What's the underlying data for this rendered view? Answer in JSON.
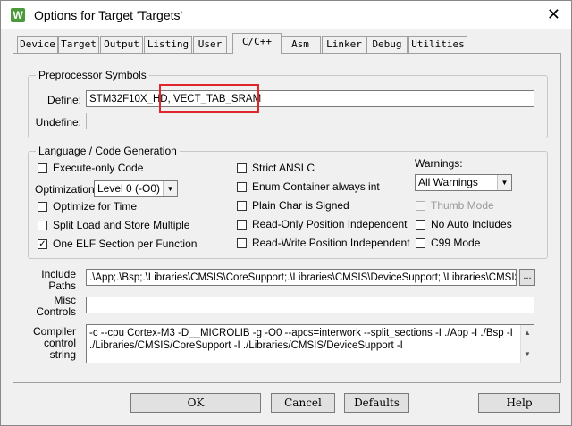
{
  "window": {
    "title": "Options for Target 'Targets'",
    "icon_letter": "W",
    "close_glyph": "✕"
  },
  "tabs": [
    {
      "label": "Device",
      "active": false
    },
    {
      "label": "Target",
      "active": false
    },
    {
      "label": "Output",
      "active": false
    },
    {
      "label": "Listing",
      "active": false
    },
    {
      "label": "User",
      "active": false
    },
    {
      "label": "C/C++",
      "active": true
    },
    {
      "label": "Asm",
      "active": false
    },
    {
      "label": "Linker",
      "active": false
    },
    {
      "label": "Debug",
      "active": false
    },
    {
      "label": "Utilities",
      "active": false
    }
  ],
  "preprocessor": {
    "group_label": "Preprocessor Symbols",
    "define_label": "Define:",
    "define_value": "STM32F10X_HD, VECT_TAB_SRAM",
    "undefine_label": "Undefine:",
    "undefine_value": ""
  },
  "language": {
    "group_label": "Language / Code Generation",
    "execute_only": {
      "label": "Execute-only Code",
      "checked": false
    },
    "optimization_label": "Optimization:",
    "optimization_value": "Level 0 (-O0)",
    "optimize_time": {
      "label": "Optimize for Time",
      "checked": false
    },
    "split_load": {
      "label": "Split Load and Store Multiple",
      "checked": false
    },
    "one_elf": {
      "label": "One ELF Section per Function",
      "checked": true
    },
    "strict_ansi": {
      "label": "Strict ANSI C",
      "checked": false
    },
    "enum_container": {
      "label": "Enum Container always int",
      "checked": false
    },
    "plain_char": {
      "label": "Plain Char is Signed",
      "checked": false
    },
    "ro_pi": {
      "label": "Read-Only Position Independent",
      "checked": false
    },
    "rw_pi": {
      "label": "Read-Write Position Independent",
      "checked": false
    },
    "warnings_label": "Warnings:",
    "warnings_value": "All Warnings",
    "thumb_mode": {
      "label": "Thumb Mode",
      "checked": false,
      "disabled": true
    },
    "no_auto_includes": {
      "label": "No Auto Includes",
      "checked": false
    },
    "c99_mode": {
      "label": "C99 Mode",
      "checked": false
    }
  },
  "include_paths": {
    "label_line1": "Include",
    "label_line2": "Paths",
    "value": ".\\App;.\\Bsp;.\\Libraries\\CMSIS\\CoreSupport;.\\Libraries\\CMSIS\\DeviceSupport;.\\Libraries\\CMSIS\\De",
    "browse_label": "..."
  },
  "misc_controls": {
    "label_line1": "Misc",
    "label_line2": "Controls",
    "value": ""
  },
  "compiler_control": {
    "label_line1": "Compiler",
    "label_line2": "control",
    "label_line3": "string",
    "line1": "-c --cpu Cortex-M3 -D__MICROLIB -g -O0 --apcs=interwork --split_sections -I ./App -I ./Bsp -I",
    "line2": "./Libraries/CMSIS/CoreSupport -I ./Libraries/CMSIS/DeviceSupport -I"
  },
  "buttons": {
    "ok": "OK",
    "cancel": "Cancel",
    "defaults": "Defaults",
    "help": "Help"
  },
  "colors": {
    "highlight_box": "#e0262c"
  }
}
